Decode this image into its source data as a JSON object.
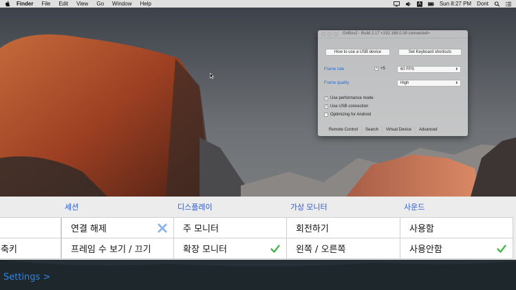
{
  "menubar": {
    "menus": [
      "Finder",
      "File",
      "Edit",
      "View",
      "Go",
      "Window",
      "Help"
    ],
    "clock": "Sun 8:27 PM",
    "user": "Dont",
    "input_badge": "A"
  },
  "app_window": {
    "title": "OnBox2 - Build 2.17 <192.168.0.39 connected>",
    "usb_button": "How to use a USB device",
    "shortcuts_button": "Set Keyboard shortcuts",
    "frame_rate_label": "Frame rate",
    "frame_rate_check": "+5",
    "frame_rate_value": "60  FPS",
    "frame_quality_label": "Frame quality",
    "frame_quality_value": "High",
    "options": [
      {
        "label": "Use performance mode",
        "checked": true
      },
      {
        "label": "Use USB connection",
        "checked": true
      },
      {
        "label": "Optimizing for Android",
        "checked": false
      }
    ],
    "tabs": [
      "Remote Control",
      "Search",
      "Virtual Device",
      "Advanced"
    ]
  },
  "panel": {
    "columns": [
      {
        "header": "",
        "items": [
          "",
          "축키"
        ]
      },
      {
        "header": "세션",
        "items": [
          "연결 해제",
          "프레임 수 보기 / 끄기"
        ]
      },
      {
        "header": "디스플레이",
        "items": [
          "주 모니터",
          "확장 모니터"
        ]
      },
      {
        "header": "가상 모니터",
        "items": [
          "회전하기",
          "왼쪽 / 오른쪽"
        ]
      },
      {
        "header": "사운드",
        "items": [
          "사용함",
          "사용안함"
        ]
      }
    ],
    "settings_link": "Settings >"
  },
  "colors": {
    "accent": "#2a58d6",
    "link": "#2f86e6",
    "check": "#46b84a",
    "x_mark": "#8fb5e8"
  }
}
